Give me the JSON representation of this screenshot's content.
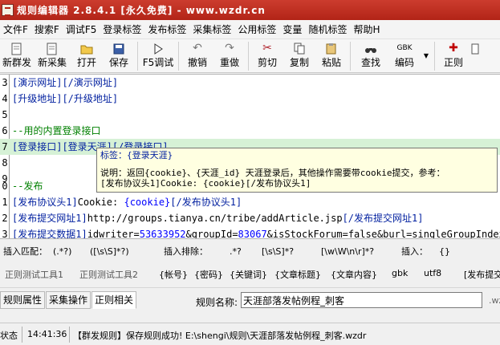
{
  "window": {
    "title": "规则编辑器 2.8.4.1 [永久免费] - www.wzdr.cn"
  },
  "menu": [
    "文件F",
    "搜索F",
    "调试F5",
    "登录标签",
    "发布标签",
    "采集标签",
    "公用标签",
    "变量",
    "随机标签",
    "帮助H"
  ],
  "toolbar": [
    {
      "label": "新群发",
      "icon": "new-send-icon"
    },
    {
      "label": "新采集",
      "icon": "new-collect-icon"
    },
    {
      "label": "打开",
      "icon": "open-folder-icon"
    },
    {
      "label": "保存",
      "icon": "save-icon"
    },
    {
      "label": "F5调试",
      "icon": "debug-icon"
    },
    {
      "label": "撤销",
      "icon": "undo-icon"
    },
    {
      "label": "重做",
      "icon": "redo-icon"
    },
    {
      "label": "剪切",
      "icon": "cut-icon"
    },
    {
      "label": "复制",
      "icon": "copy-icon"
    },
    {
      "label": "粘贴",
      "icon": "paste-icon"
    },
    {
      "label": "查找",
      "icon": "find-icon"
    },
    {
      "label": "编码",
      "icon": "encoding-icon",
      "icon_text": "GBK"
    },
    {
      "label": "正则",
      "icon": "regex-icon"
    },
    {
      "label": "",
      "icon": "more-icon"
    }
  ],
  "editor": {
    "lines": [
      {
        "no": "3",
        "text": "[演示网址][/演示网址]",
        "kind": "tag"
      },
      {
        "no": "4",
        "text": "[升级地址][/升级地址]",
        "kind": "tag"
      },
      {
        "no": "5",
        "text": "",
        "kind": "plain"
      },
      {
        "no": "6",
        "text": "--用的内置登录接口",
        "kind": "comment"
      },
      {
        "no": "7",
        "text": "[登录接口][登录天涯][/登录接口]",
        "kind": "tag",
        "highlight": true
      },
      {
        "no": "8",
        "text": "",
        "kind": "plain"
      },
      {
        "no": "9",
        "text": "",
        "kind": "plain"
      },
      {
        "no": "0",
        "text": "--发布",
        "kind": "comment"
      },
      {
        "no": "1",
        "open": "[发布协议头1]",
        "body": "Cookie: ",
        "var": "{cookie}",
        "close": "[/发布协议头1]",
        "kind": "mixed"
      },
      {
        "no": "2",
        "open": "[发布提交网址1]",
        "body": "http://groups.tianya.cn/tribe/addArticle.jsp",
        "var": "",
        "close": "[/发布提交网址1]",
        "kind": "mixed"
      },
      {
        "no": "3",
        "open": "[发布提交数据1]",
        "body": "idwriter=",
        "var": "53633952",
        "body2": "&groupId=",
        "var2": "83067",
        "body3": "&isStockForum=false&burl=singleGroupIndex.",
        "kind": "data"
      }
    ],
    "tooltip": {
      "line1": "标签：{登录天涯}",
      "line2": "说明：返回{cookie}、{天涯_id} 天涯登录后，其他操作需要带cookie提交，参考：",
      "line3": "[发布协议头1]Cookie: {cookie}[/发布协议头1]"
    }
  },
  "insert_bar": {
    "match_label": "插入匹配：",
    "match_items": [
      "(.*?)",
      "([\\s\\S]*?)"
    ],
    "exclude_label": "插入排除：",
    "exclude_items": [
      ".*?",
      "[\\s\\S]*?",
      "[\\w\\W\\n\\r]*?"
    ],
    "insert_label": "插入：",
    "insert_items": [
      "{}"
    ]
  },
  "regex_bar": {
    "tools": [
      "正则测试工具1",
      "正则测试工具2"
    ],
    "items": [
      "{帐号}",
      "{密码}",
      "{关键词}",
      "{文章标题}",
      "{文章内容}",
      "gbk",
      "utf8",
      "[发布提交"
    ]
  },
  "tabs": [
    "规则属性",
    "采集操作",
    "正则相关"
  ],
  "rule_name": {
    "label": "规则名称:",
    "value": "天涯部落发帖例程_刺客",
    "tail": ".wz"
  },
  "status": {
    "label": "状态",
    "time": "14:41:36",
    "message": "【群发规则】保存规则成功! E:\\shengi\\规则\\天涯部落发帖例程_刺客.wzdr"
  }
}
